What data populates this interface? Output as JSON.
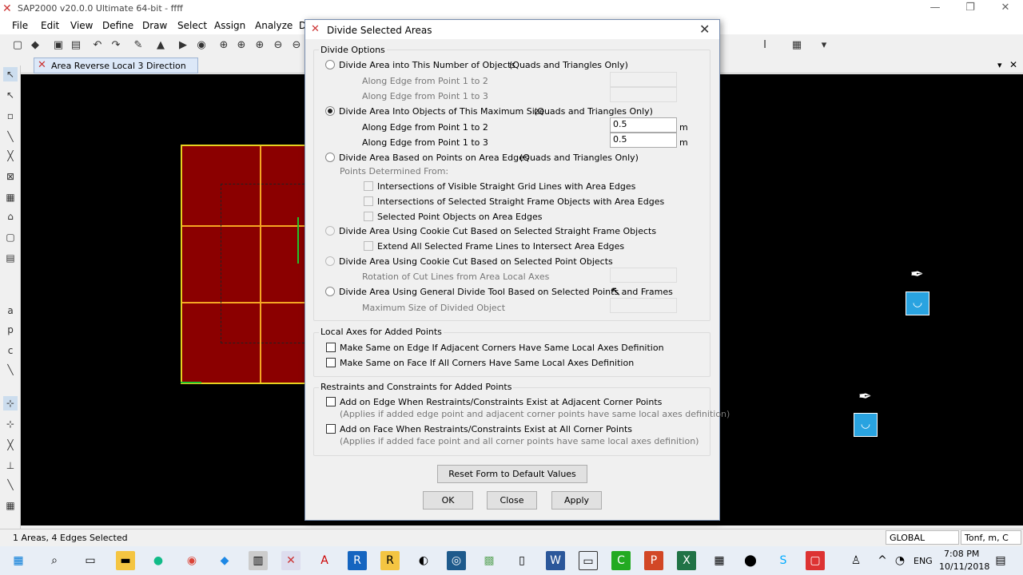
{
  "app": {
    "title": "SAP2000 v20.0.0 Ultimate 64-bit - ffff",
    "min": "—",
    "max": "❐",
    "close": "✕"
  },
  "menu": [
    "File",
    "Edit",
    "View",
    "Define",
    "Draw",
    "Select",
    "Assign",
    "Analyze",
    "D"
  ],
  "view_tab": {
    "label": "Area Reverse Local 3 Direction",
    "close": "✕",
    "arrow": "▾"
  },
  "dialog": {
    "title": "Divide Selected Areas",
    "divide_options": {
      "label": "Divide Options",
      "opt1": {
        "label": "Divide Area into This Number of Objects",
        "note": "(Quads and Triangles Only)",
        "sub1": "Along Edge from Point 1 to 2",
        "sub2": "Along Edge from Point 1 to 3"
      },
      "opt2": {
        "label": "Divide Area Into Objects of This Maximum Size",
        "note": "(Quads and Triangles Only)",
        "sub1": "Along Edge from Point 1 to 2",
        "sub2": "Along Edge from Point 1 to 3",
        "val1": "0.5",
        "val2": "0.5",
        "unit": "m"
      },
      "opt3": {
        "label": "Divide Area Based on Points on Area Edges",
        "note": "(Quads and Triangles Only)",
        "sub": "Points Determined From:",
        "c1": "Intersections of Visible Straight Grid Lines with Area Edges",
        "c2": "Intersections of Selected Straight Frame Objects with Area Edges",
        "c3": "Selected Point Objects on Area Edges"
      },
      "opt4": {
        "label": "Divide Area Using Cookie Cut Based on Selected Straight Frame Objects",
        "c1": "Extend All Selected Frame Lines to Intersect Area Edges"
      },
      "opt5": {
        "label": "Divide Area Using Cookie Cut Based on Selected Point Objects",
        "sub": "Rotation of Cut Lines from Area Local Axes"
      },
      "opt6": {
        "label": "Divide Area Using General Divide Tool Based on Selected Points and Frames",
        "sub": "Maximum Size of Divided Object"
      }
    },
    "local_axes": {
      "label": "Local Axes for Added Points",
      "c1": "Make Same on Edge If Adjacent Corners Have Same Local Axes Definition",
      "c2": "Make Same on Face If All Corners Have Same Local Axes Definition"
    },
    "restraints": {
      "label": "Restraints and Constraints for Added Points",
      "c1": "Add on Edge When Restraints/Constraints Exist at Adjacent Corner Points",
      "c1_note": "(Applies if added edge point and adjacent corner points have same local axes definition)",
      "c2": "Add on Face When Restraints/Constraints Exist at All Corner Points",
      "c2_note": "(Applies if added face point and all corner points have same local axes definition)"
    },
    "reset": "Reset Form to Default Values",
    "ok": "OK",
    "close": "Close",
    "apply": "Apply",
    "close_icon": "✕"
  },
  "status": {
    "text": "1 Areas, 4 Edges Selected",
    "coord": "GLOBAL",
    "units": "Tonf, m, C"
  },
  "taskbar": {
    "time": "7:08 PM",
    "date": "10/11/2018",
    "lang": "ENG"
  },
  "colors": {
    "area": "#8b0000",
    "accent": "#29a3e0"
  }
}
